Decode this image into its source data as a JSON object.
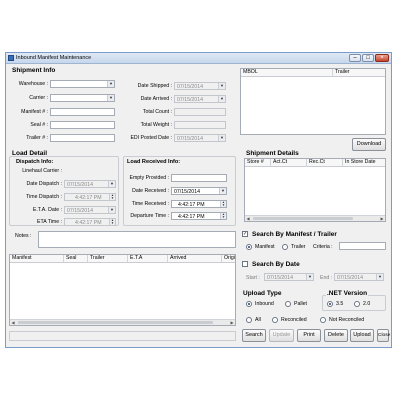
{
  "window": {
    "title": "Inbound Manifest Maintenance"
  },
  "icons": {
    "app": "document-icon",
    "minimize": "minimize-icon",
    "maximize": "maximize-icon",
    "close": "close-icon"
  },
  "colors": {
    "title_bar": "#c6d7ec",
    "window_bg": "#f0f0f0",
    "close_button": "#c8442d"
  },
  "shipment_info": {
    "title": "Shipment Info",
    "warehouse_label": "Warehouse :",
    "carrier_label": "Carrier :",
    "manifest_label": "Manifest # :",
    "seal_label": "Seal # :",
    "trailer_label": "Trailer # :",
    "date_shipped_label": "Date Shipped :",
    "date_shipped_value": "07/15/2014",
    "date_arrived_label": "Date Arrived :",
    "date_arrived_value": "07/15/2014",
    "total_count_label": "Total Count :",
    "total_weight_label": "Total Weight :",
    "edi_posted_label": "EDI Posted Date :",
    "edi_posted_value": "07/15/2014"
  },
  "mbol": {
    "col_mbol": "MBOL",
    "col_trailer": "Trailer",
    "download_label": "Download"
  },
  "load_detail": {
    "title": "Load Detail",
    "dispatch_title": "Dispatch Info:",
    "linehaul_label": "Linehaul Carrier :",
    "date_dispatch_label": "Date Dispatch :",
    "date_dispatch_value": "07/15/2014",
    "time_dispatch_label": "Time Dispatch :",
    "time_dispatch_value": "4:42:17 PM",
    "eta_date_label": "E.T.A. Date :",
    "eta_date_value": "07/15/2014",
    "eta_time_label": "ETA Time :",
    "eta_time_value": "4:42:17 PM",
    "received_title": "Load Received Info:",
    "empty_provided_label": "Empty Provided :",
    "date_received_label": "Date Received :",
    "date_received_value": "07/15/2014",
    "time_received_label": "Time Received :",
    "time_received_value": "4:42:17 PM",
    "departure_time_label": "Departure Time :",
    "departure_time_value": "4:42:17 PM",
    "notes_label": "Notes :"
  },
  "shipment_details": {
    "title": "Shipment Details",
    "columns": [
      "Store #",
      "Act.Ct",
      "Rec.Ct",
      "In Store Date"
    ]
  },
  "manifest_grid": {
    "columns": [
      "Manifest",
      "Seal",
      "Trailer",
      "E.T.A",
      "Arrived",
      "Origi"
    ]
  },
  "search_manifest": {
    "title": "Search By Manifest / Trailer",
    "checked": true,
    "manifest_label": "Manifest",
    "trailer_label": "Trailer",
    "criteria_label": "Criteria :"
  },
  "search_date": {
    "title": "Search By Date",
    "checked": false,
    "start_label": "Start :",
    "start_value": "07/15/2014",
    "end_label": "End :",
    "end_value": "07/15/2014"
  },
  "upload_type": {
    "title": "Upload Type",
    "inbound_label": "Inbound",
    "pallet_label": "Pallet"
  },
  "net_version": {
    "title": ".NET Version",
    "v35_label": "3.5",
    "v20_label": "2.0"
  },
  "reconcile": {
    "all_label": "All",
    "reconciled_label": "Reconciled",
    "not_reconciled_label": "Not Reconciled"
  },
  "buttons": {
    "search": "Search",
    "update": "Update",
    "print": "Print",
    "delete": "Delete",
    "upload": "Upload",
    "close": "Close"
  }
}
